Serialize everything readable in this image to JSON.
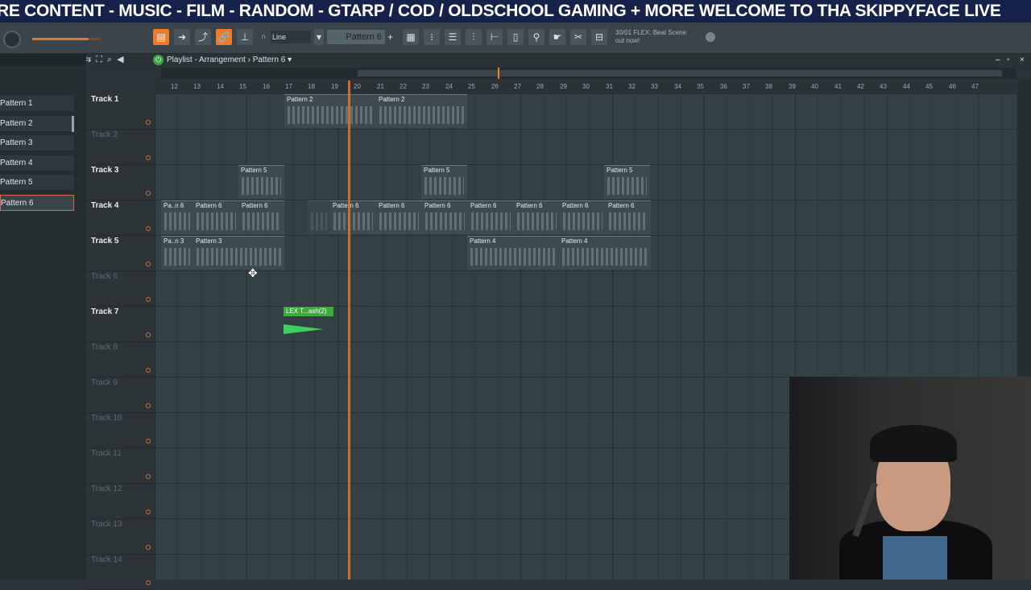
{
  "ticker": {
    "text": "RE CONTENT - MUSIC - FILM - RANDOM - GTARP / COD / OLDSCHOOL GAMING + MORE  WELCOME TO THA SKIPPYFACE LIVE"
  },
  "toolbar": {
    "snap_label": "Line",
    "pattern_selector": "Pattern 6",
    "pattern_add": "+",
    "news_line1": "30/01  FLEX: Beat Scene",
    "news_line2": "out now!"
  },
  "playlist": {
    "title": "Playlist - Arrangement › Pattern 6 ▾",
    "window_controls": [
      "–",
      "▫",
      "×"
    ]
  },
  "patterns": [
    "Pattern 1",
    "Pattern 2",
    "Pattern 3",
    "Pattern 4",
    "Pattern 5",
    "Pattern 6"
  ],
  "selected_pattern": "Pattern 6",
  "ruler_ticks": [
    "12",
    "13",
    "14",
    "15",
    "16",
    "17",
    "18",
    "19",
    "20",
    "21",
    "22",
    "23",
    "24",
    "25",
    "26",
    "27",
    "28",
    "29",
    "30",
    "31",
    "32",
    "33",
    "34",
    "35",
    "36",
    "37",
    "38",
    "39",
    "40",
    "41",
    "42",
    "43",
    "44",
    "45",
    "46",
    "47"
  ],
  "tracks": [
    {
      "name": "Track 1",
      "active": true
    },
    {
      "name": "Track 2",
      "active": false
    },
    {
      "name": "Track 3",
      "active": true
    },
    {
      "name": "Track 4",
      "active": true
    },
    {
      "name": "Track 5",
      "active": true
    },
    {
      "name": "Track 6",
      "active": false
    },
    {
      "name": "Track 7",
      "active": true
    },
    {
      "name": "Track 8",
      "active": false
    },
    {
      "name": "Track 9",
      "active": false
    },
    {
      "name": "Track 10",
      "active": false
    },
    {
      "name": "Track 11",
      "active": false
    },
    {
      "name": "Track 12",
      "active": false
    },
    {
      "name": "Track 13",
      "active": false
    },
    {
      "name": "Track 14",
      "active": false
    }
  ],
  "clips": {
    "t1a": "Pattern 2",
    "t1b": "Pattern 2",
    "t3a": "Pattern 5",
    "t3b": "Pattern 5",
    "t3c": "Pattern 5",
    "t4a": "Pa..n 6",
    "t4b": "Pattern 6",
    "t4c": "Pattern 6",
    "t4d": "Pattern 6",
    "t4e": "Pattern 6",
    "t4f": "Pattern 6",
    "t4g": "Pattern 6",
    "t4h": "Pattern 6",
    "t4i": "Pattern 6",
    "t4j": "Pattern 6",
    "t4k": "Pattern 6",
    "t5a": "Pa..n 3",
    "t5b": "Pattern 3",
    "t5c": "Pattern 4",
    "t5d": "Pattern 4",
    "audio": "LEX T...ash(2)"
  },
  "colors": {
    "playhead": "#e0702a",
    "audio_clip": "#3caa3c",
    "ticker_bg": "#16224a"
  }
}
